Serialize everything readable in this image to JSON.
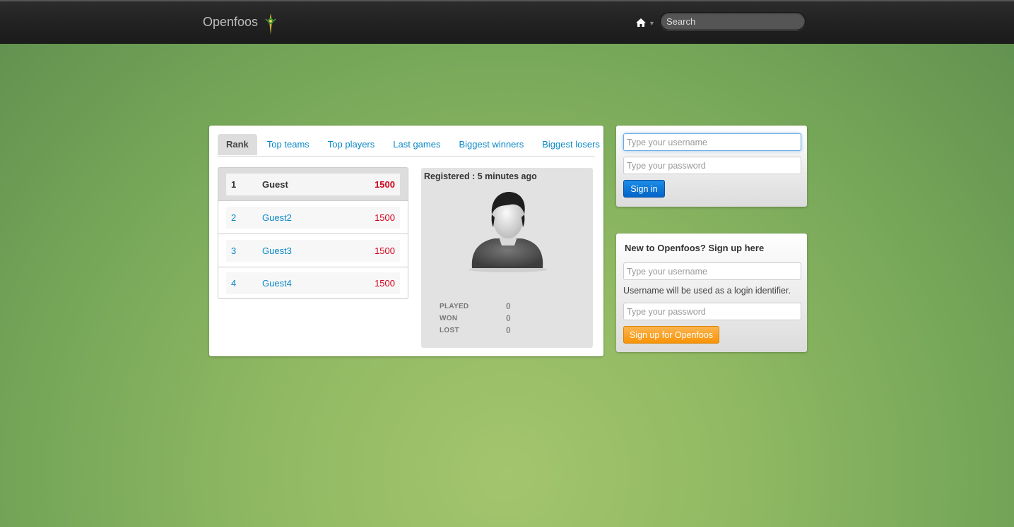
{
  "navbar": {
    "brand": "Openfoos",
    "search_placeholder": "Search"
  },
  "tabs": [
    {
      "label": "Rank",
      "active": true
    },
    {
      "label": "Top teams"
    },
    {
      "label": "Top players"
    },
    {
      "label": "Last games"
    },
    {
      "label": "Biggest winners"
    },
    {
      "label": "Biggest losers"
    }
  ],
  "ranking": [
    {
      "rank": "1",
      "name": "Guest",
      "score": "1500"
    },
    {
      "rank": "2",
      "name": "Guest2",
      "score": "1500"
    },
    {
      "rank": "3",
      "name": "Guest3",
      "score": "1500"
    },
    {
      "rank": "4",
      "name": "Guest4",
      "score": "1500"
    }
  ],
  "profile": {
    "registered": "Registered : 5 minutes ago",
    "stats": [
      {
        "label": "PLAYED",
        "value": "0"
      },
      {
        "label": "WON",
        "value": "0"
      },
      {
        "label": "LOST",
        "value": "0"
      }
    ]
  },
  "login": {
    "username_placeholder": "Type your username",
    "password_placeholder": "Type your password",
    "submit": "Sign in"
  },
  "signup": {
    "title": "New to Openfoos? Sign up here",
    "username_placeholder": "Type your username",
    "help": "Username will be used as a login identifier.",
    "password_placeholder": "Type your password",
    "submit": "Sign up for Openfoos"
  },
  "colors": {
    "link": "#0a88c6",
    "score": "#d0021b",
    "primary_button": "#0465c8",
    "warning_button": "#f89406",
    "background": "#8fb862"
  }
}
